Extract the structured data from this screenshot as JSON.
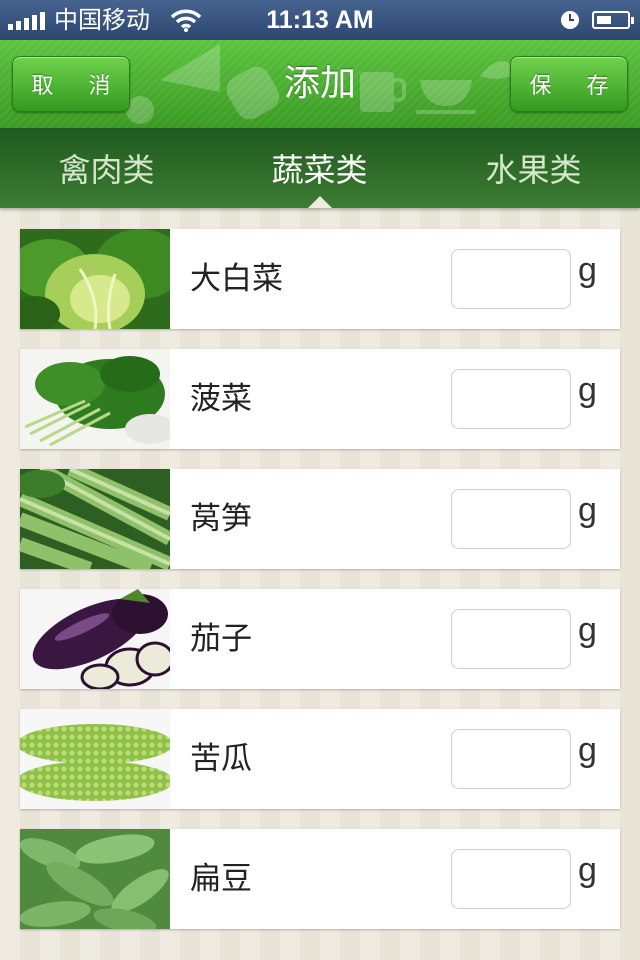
{
  "status_bar": {
    "carrier": "中国移动",
    "time": "11:13 AM",
    "icons": [
      "signal-icon",
      "wifi-icon",
      "clock-icon",
      "battery-icon"
    ]
  },
  "navbar": {
    "title": "添加",
    "cancel_label": "取 消",
    "save_label": "保 存",
    "background_color": "#4aae2e"
  },
  "tabs": [
    {
      "label": "禽肉类",
      "active": false
    },
    {
      "label": "蔬菜类",
      "active": true
    },
    {
      "label": "水果类",
      "active": false
    }
  ],
  "items": [
    {
      "name": "大白菜",
      "value": "",
      "unit": "g",
      "image": "napa-cabbage-image"
    },
    {
      "name": "菠菜",
      "value": "",
      "unit": "g",
      "image": "spinach-image"
    },
    {
      "name": "莴笋",
      "value": "",
      "unit": "g",
      "image": "celtuce-image"
    },
    {
      "name": "茄子",
      "value": "",
      "unit": "g",
      "image": "eggplant-image"
    },
    {
      "name": "苦瓜",
      "value": "",
      "unit": "g",
      "image": "bitter-melon-image"
    },
    {
      "name": "扁豆",
      "value": "",
      "unit": "g",
      "image": "hyacinth-bean-image"
    }
  ]
}
